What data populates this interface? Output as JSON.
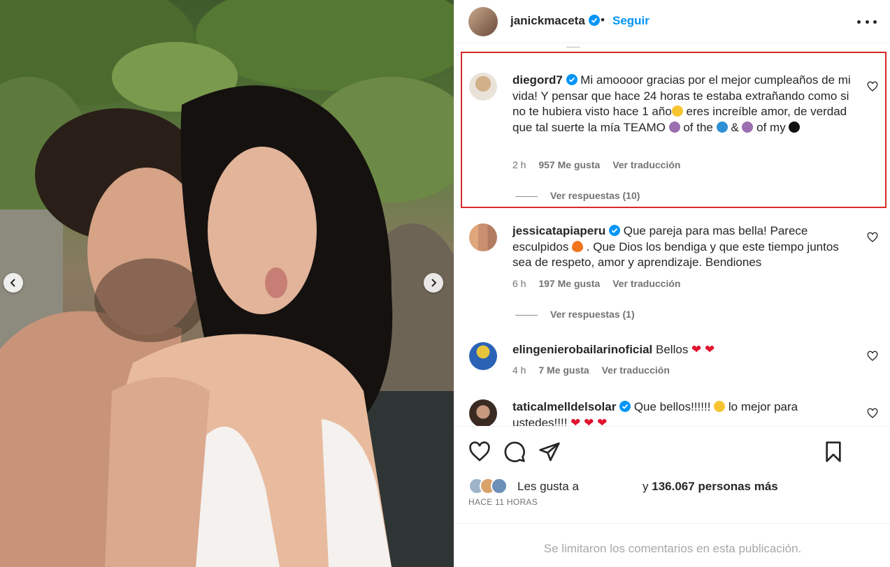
{
  "post": {
    "username": "janickmaceta",
    "dot": "•",
    "follow_label": "Seguir"
  },
  "comments": [
    {
      "username": "diegord7",
      "text": "Mi amoooor gracias por el mejor cumpleaños de mi vida! Y pensar que hace 24 horas te estaba extrañando como si no te hubiera visto hace 1 año",
      "text2": " eres increíble amor, de verdad que tal suerte la mía TEAMO ",
      "text3": " of the ",
      "text4": " & ",
      "text5": " of my ",
      "time": "2 h",
      "likes": "957 Me gusta",
      "translate": "Ver traducción",
      "replies": "Ver respuestas (10)"
    },
    {
      "username": "jessicatapiaperu",
      "text": "Que pareja para mas bella! Parece esculpidos ",
      "text2": " . Que Dios los bendiga y que este tiempo juntos sea de respeto, amor y aprendizaje. Bendiones",
      "time": "6 h",
      "likes": "197 Me gusta",
      "translate": "Ver traducción",
      "replies": "Ver respuestas (1)"
    },
    {
      "username": "elingenierobailarinoficial",
      "text": "Bellos ",
      "time": "4 h",
      "likes": "7 Me gusta",
      "translate": "Ver traducción"
    },
    {
      "username": "taticalmelldelsolar",
      "text": "Que bellos!!!!!! ",
      "text2": " lo mejor para ustedes!!!! "
    }
  ],
  "likes": {
    "prefix": "Les gusta a",
    "connector": "y",
    "count": "136.067 personas más"
  },
  "time_ago": "HACE 11 HORAS",
  "footer_note": "Se limitaron los comentarios en esta publicación.",
  "icons": {
    "verified": "verified-badge-icon",
    "heart": "heart-icon",
    "comment": "comment-icon",
    "share": "share-icon",
    "save": "bookmark-icon",
    "more": "more-options-icon"
  },
  "colors": {
    "accent": "#0095f6",
    "highlight_border": "#d62b2b",
    "muted": "#737373"
  }
}
